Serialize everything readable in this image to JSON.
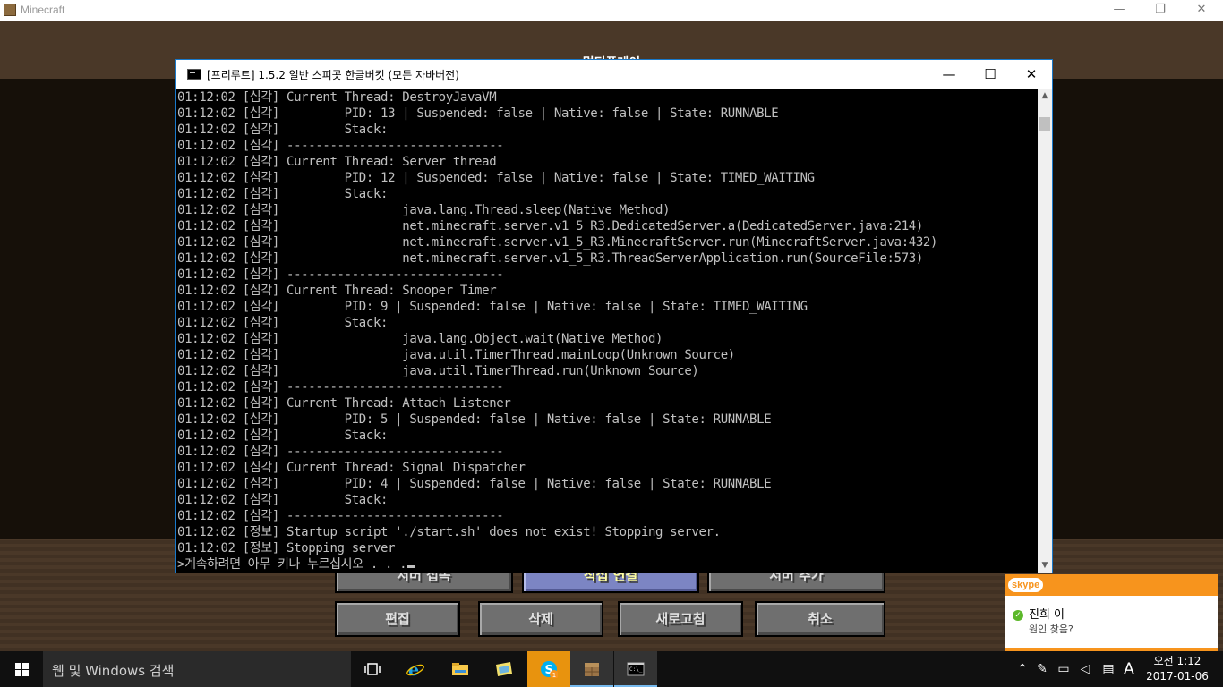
{
  "minecraft": {
    "window_title": "Minecraft",
    "controls": {
      "minimize": "—",
      "restore": "❐",
      "close": "✕"
    },
    "screen_title": "멀티플레이",
    "buttons_row1": [
      {
        "label": "서버 접속",
        "highlight": false
      },
      {
        "label": "직접 연결",
        "highlight": true
      },
      {
        "label": "서버 추가",
        "highlight": false
      }
    ],
    "buttons_row2": [
      {
        "label": "편집"
      },
      {
        "label": "삭제"
      },
      {
        "label": "새로고침"
      },
      {
        "label": "취소"
      }
    ]
  },
  "cmd": {
    "title": "[프리루트] 1.5.2 일반 스피곳 한글버킷 (모든 자바버전)",
    "controls": {
      "minimize": "—",
      "maximize": "☐",
      "close": "✕"
    },
    "lines": [
      "01:12:02 [심각] Current Thread: DestroyJavaVM",
      "01:12:02 [심각]         PID: 13 | Suspended: false | Native: false | State: RUNNABLE",
      "01:12:02 [심각]         Stack:",
      "01:12:02 [심각] ------------------------------",
      "01:12:02 [심각] Current Thread: Server thread",
      "01:12:02 [심각]         PID: 12 | Suspended: false | Native: false | State: TIMED_WAITING",
      "01:12:02 [심각]         Stack:",
      "01:12:02 [심각]                 java.lang.Thread.sleep(Native Method)",
      "01:12:02 [심각]                 net.minecraft.server.v1_5_R3.DedicatedServer.a(DedicatedServer.java:214)",
      "01:12:02 [심각]                 net.minecraft.server.v1_5_R3.MinecraftServer.run(MinecraftServer.java:432)",
      "01:12:02 [심각]                 net.minecraft.server.v1_5_R3.ThreadServerApplication.run(SourceFile:573)",
      "01:12:02 [심각] ------------------------------",
      "01:12:02 [심각] Current Thread: Snooper Timer",
      "01:12:02 [심각]         PID: 9 | Suspended: false | Native: false | State: TIMED_WAITING",
      "01:12:02 [심각]         Stack:",
      "01:12:02 [심각]                 java.lang.Object.wait(Native Method)",
      "01:12:02 [심각]                 java.util.TimerThread.mainLoop(Unknown Source)",
      "01:12:02 [심각]                 java.util.TimerThread.run(Unknown Source)",
      "01:12:02 [심각] ------------------------------",
      "01:12:02 [심각] Current Thread: Attach Listener",
      "01:12:02 [심각]         PID: 5 | Suspended: false | Native: false | State: RUNNABLE",
      "01:12:02 [심각]         Stack:",
      "01:12:02 [심각] ------------------------------",
      "01:12:02 [심각] Current Thread: Signal Dispatcher",
      "01:12:02 [심각]         PID: 4 | Suspended: false | Native: false | State: RUNNABLE",
      "01:12:02 [심각]         Stack:",
      "01:12:02 [심각] ------------------------------",
      "01:12:02 [정보] Startup script './start.sh' does not exist! Stopping server.",
      "01:12:02 [정보] Stopping server"
    ],
    "prompt": ">계속하려면 아무 키나 누르십시오 . . ."
  },
  "skype": {
    "brand": "skype",
    "contact_name": "진희 이",
    "message": "원인 찾음?",
    "colors": {
      "accent": "#f7941d",
      "online": "#5cb82a"
    }
  },
  "taskbar": {
    "search_placeholder": "웹 및 Windows 검색",
    "apps": [
      {
        "icon": "task-view-icon",
        "active": false
      },
      {
        "icon": "internet-explorer-icon",
        "active": false
      },
      {
        "icon": "file-explorer-icon",
        "active": false
      },
      {
        "icon": "photos-icon",
        "active": false
      },
      {
        "icon": "skype-icon",
        "active": true,
        "badge": "1"
      },
      {
        "icon": "minecraft-icon",
        "active": true
      },
      {
        "icon": "command-prompt-icon",
        "active": true
      }
    ],
    "ime_mode": "A",
    "time": "오전 1:12",
    "date": "2017-01-06"
  }
}
